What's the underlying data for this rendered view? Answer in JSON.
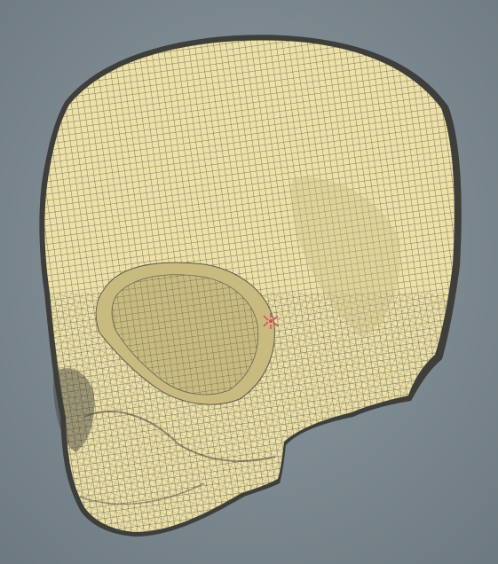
{
  "viewport": {
    "background_center": "#8e9aa1",
    "background_edge": "#6d7980",
    "mesh_fill": "#ede1a8",
    "mesh_shadow": "#c9bb80",
    "mesh_wire": "#5b5a4c",
    "mesh_edge": "#3e3e3a",
    "selection_marker": "#e0405a"
  },
  "scene": {
    "object": "skull-mesh",
    "display_mode": "wireframe-on-shaded",
    "marker_icon": "crosshair-cursor-icon"
  }
}
